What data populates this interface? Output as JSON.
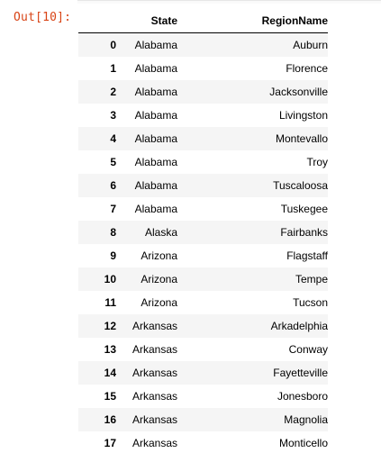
{
  "prompt_label": "Out[10]:",
  "table": {
    "columns": [
      "",
      "State",
      "RegionName"
    ],
    "rows": [
      {
        "index": "0",
        "state": "Alabama",
        "region": "Auburn"
      },
      {
        "index": "1",
        "state": "Alabama",
        "region": "Florence"
      },
      {
        "index": "2",
        "state": "Alabama",
        "region": "Jacksonville"
      },
      {
        "index": "3",
        "state": "Alabama",
        "region": "Livingston"
      },
      {
        "index": "4",
        "state": "Alabama",
        "region": "Montevallo"
      },
      {
        "index": "5",
        "state": "Alabama",
        "region": "Troy"
      },
      {
        "index": "6",
        "state": "Alabama",
        "region": "Tuscaloosa"
      },
      {
        "index": "7",
        "state": "Alabama",
        "region": "Tuskegee"
      },
      {
        "index": "8",
        "state": "Alaska",
        "region": "Fairbanks"
      },
      {
        "index": "9",
        "state": "Arizona",
        "region": "Flagstaff"
      },
      {
        "index": "10",
        "state": "Arizona",
        "region": "Tempe"
      },
      {
        "index": "11",
        "state": "Arizona",
        "region": "Tucson"
      },
      {
        "index": "12",
        "state": "Arkansas",
        "region": "Arkadelphia"
      },
      {
        "index": "13",
        "state": "Arkansas",
        "region": "Conway"
      },
      {
        "index": "14",
        "state": "Arkansas",
        "region": "Fayetteville"
      },
      {
        "index": "15",
        "state": "Arkansas",
        "region": "Jonesboro"
      },
      {
        "index": "16",
        "state": "Arkansas",
        "region": "Magnolia"
      },
      {
        "index": "17",
        "state": "Arkansas",
        "region": "Monticello"
      }
    ]
  },
  "colors": {
    "prompt": "#d84315",
    "stripe": "#f5f5f5",
    "header_rule": "#000000"
  }
}
